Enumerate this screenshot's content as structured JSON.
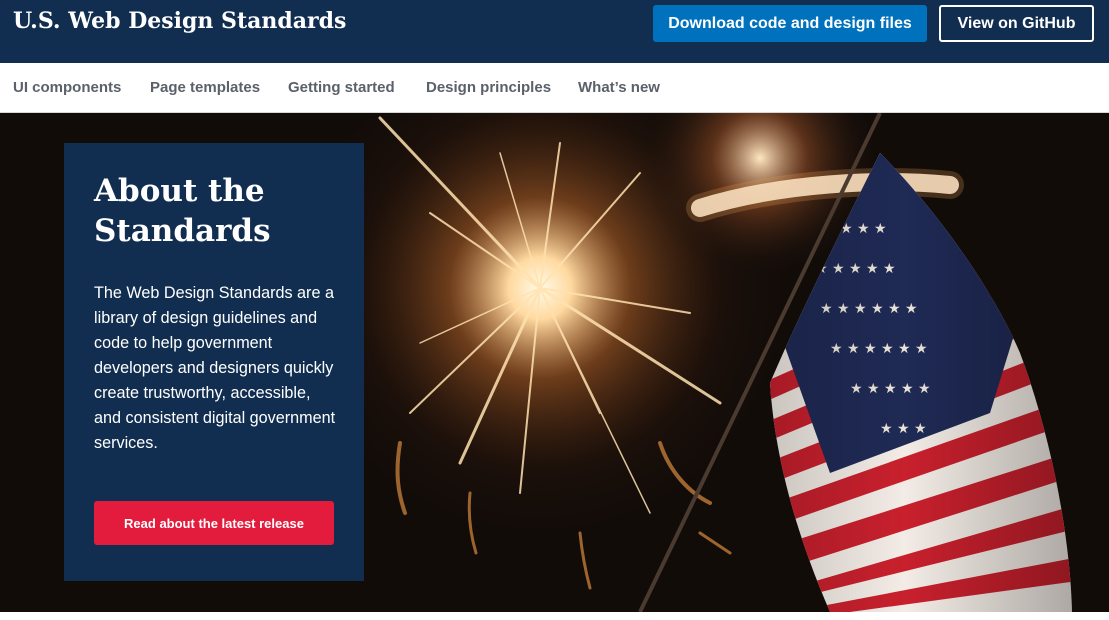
{
  "header": {
    "site_title": "U.S. Web Design Standards",
    "download_label": "Download code and design files",
    "github_label": "View on GitHub"
  },
  "nav": {
    "items": [
      {
        "label": "UI components"
      },
      {
        "label": "Page templates"
      },
      {
        "label": "Getting started"
      },
      {
        "label": "Design principles"
      },
      {
        "label": "What’s new"
      }
    ]
  },
  "hero": {
    "title": "About the Standards",
    "body": "The Web Design Standards are a library of design guidelines and code to help government developers and designers quickly create trustworthy, accessible, and consistent digital government services.",
    "button_label": "Read about the latest release",
    "image": "sparkler-and-american-flag-photo"
  },
  "colors": {
    "primary_dark": "#112e51",
    "primary": "#0071bc",
    "secondary": "#e31c3d",
    "nav_text": "#5b616b"
  }
}
